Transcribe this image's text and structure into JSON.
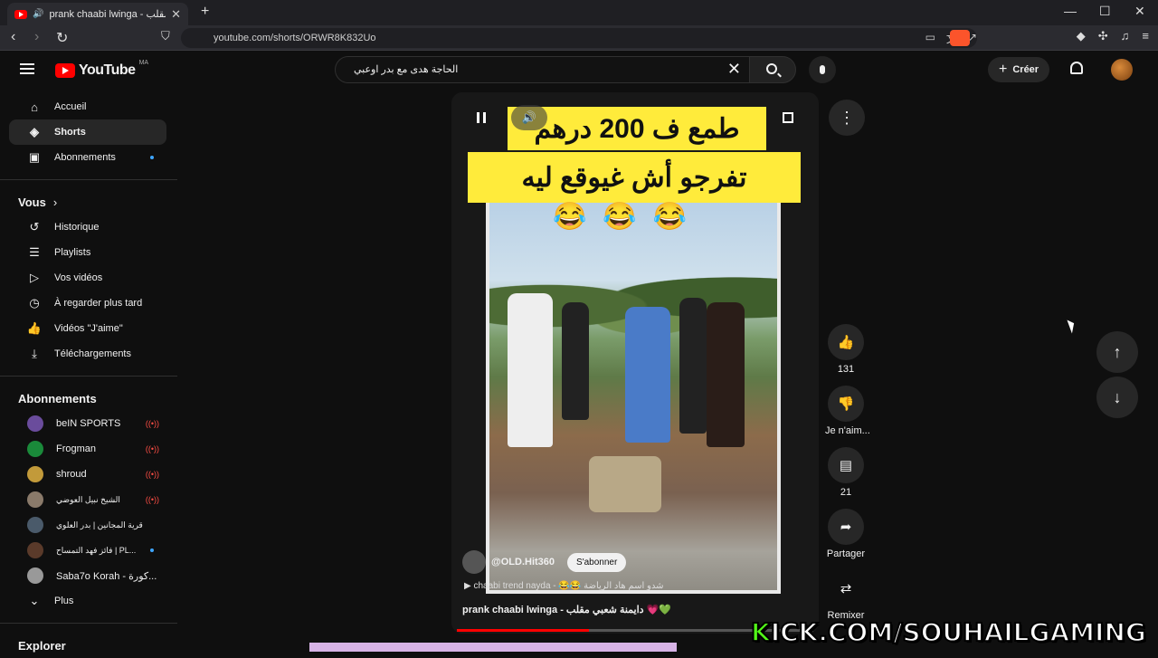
{
  "browser": {
    "tab_title": "prank chaabi lwinga - ‏مقلب",
    "url": "youtube.com/shorts/ORWR8K832Uo"
  },
  "header": {
    "logo_text": "YouTube",
    "country_code": "MA",
    "search_query": "الحاجة هدى مع بدر اوعبي",
    "create_label": "Créer"
  },
  "sidebar": {
    "main": [
      "Accueil",
      "Shorts",
      "Abonnements"
    ],
    "you_label": "Vous",
    "you_items": [
      "Historique",
      "Playlists",
      "Vos vidéos",
      "À regarder plus tard",
      "Vidéos \"J'aime\"",
      "Téléchargements"
    ],
    "subs_label": "Abonnements",
    "subs": [
      "beIN SPORTS",
      "Frogman",
      "shroud",
      "الشيخ نبيل العوضي",
      "قرية المجانين | بدر العلوي",
      "فائز فهد التمساح | PL...",
      "Saba7o Korah - كورة..."
    ],
    "more_label": "Plus",
    "explore_label": "Explorer"
  },
  "video": {
    "caption_top": "طمع ف 200 درهم",
    "caption_bottom": "تفرجو أش غيوقع ليه",
    "emojis": "😂😂😂",
    "channel": "@OLD.Hit360",
    "subscribe_label": "S'abonner",
    "description": "▶  chaabi trend nayda - 😂😂 شدو اسم هاد الرياضة",
    "title": "prank chaabi lwinga - دايمنة شعبي مقلب 💗💚",
    "progress": 0.37
  },
  "actions": {
    "likes": "131",
    "dislike_label": "Je n'aim...",
    "comments": "21",
    "share_label": "Partager",
    "remix_label": "Remixer"
  },
  "overlay": {
    "kick_text": "KICK.COM/SOUHAILGAMING"
  }
}
